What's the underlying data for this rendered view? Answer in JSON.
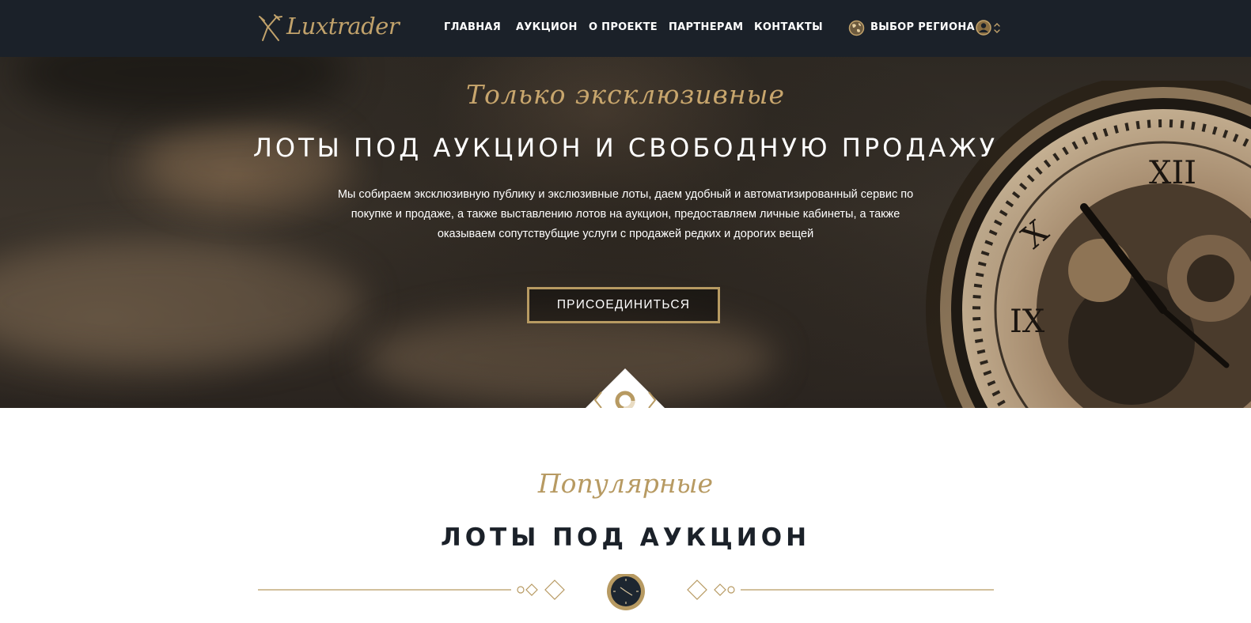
{
  "header": {
    "logo_text": "Luxtrader",
    "nav": [
      {
        "label": "ГЛАВНАЯ"
      },
      {
        "label": "АУКЦИОН"
      },
      {
        "label": "О ПРОЕКТЕ"
      },
      {
        "label": "ПАРТНЕРАМ"
      },
      {
        "label": "КОНТАКТЫ"
      }
    ],
    "region_label": "ВЫБОР РЕГИОНА",
    "icons": {
      "logo": "fork-knife-icon",
      "region": "globe-icon",
      "user": "user-icon",
      "user_menu": "chevron-up-down-icon"
    }
  },
  "hero": {
    "script_text": "Только эксклюзивные",
    "title": "ЛОТЫ ПОД АУКЦИОН И СВОБОДНУЮ ПРОДАЖУ",
    "description": "Мы собираем эксклюзивную публику и экслюзивные лоты, даем удобный и автоматизированный сервис по покупке и продаже, а также выставлению лотов на аукцион, предоставляем личные кабинеты, а также оказываем сопутствубщие услуги с продажей редких и дорогих вещей",
    "join_button": "ПРИСОЕДИНИТЬСЯ",
    "slider_icons": {
      "prev": "chevron-left-icon",
      "indicator": "ring-icon",
      "next": "chevron-right-icon"
    }
  },
  "section": {
    "script_text": "Популярные",
    "title": "ЛОТЫ ПОД АУКЦИОН",
    "divider_icon": "watch-icon"
  },
  "colors": {
    "header_bg": "#1b2129",
    "accent_gold": "#b79a62",
    "text_dark": "#1b2129"
  }
}
